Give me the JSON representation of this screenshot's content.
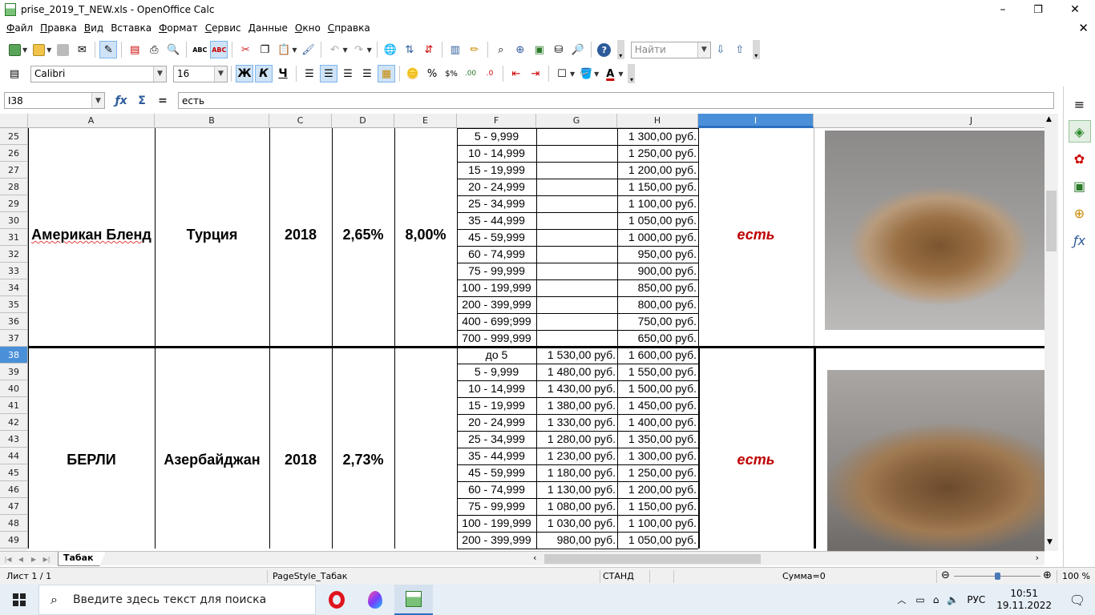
{
  "window": {
    "title": "prise_2019_T_NEW.xls - OpenOffice Calc",
    "min": "–",
    "max": "❐",
    "close": "✕",
    "doc_close": "✕"
  },
  "menu": [
    {
      "label": "Файл",
      "u": "Ф",
      "rest": "айл"
    },
    {
      "label": "Правка",
      "u": "П",
      "rest": "равка"
    },
    {
      "label": "Вид",
      "u": "В",
      "rest": "ид"
    },
    {
      "label": "Вставка",
      "u": "",
      "rest": "Вставка"
    },
    {
      "label": "Формат",
      "u": "Ф",
      "rest": "ормат"
    },
    {
      "label": "Сервис",
      "u": "С",
      "rest": "ервис"
    },
    {
      "label": "Данные",
      "u": "Д",
      "rest": "анные"
    },
    {
      "label": "Окно",
      "u": "О",
      "rest": "кно"
    },
    {
      "label": "Справка",
      "u": "С",
      "rest": "правка"
    }
  ],
  "toolbar1": {
    "find_placeholder": "Найти"
  },
  "toolbar2": {
    "font_name": "Calibri",
    "font_size": "16",
    "bold": "Ж",
    "italic": "К",
    "underline": "Ч",
    "percent": "%",
    "currency": "$%"
  },
  "formula_bar": {
    "name_box": "I38",
    "content": "есть",
    "equals": "="
  },
  "columns": [
    "A",
    "B",
    "C",
    "D",
    "E",
    "F",
    "G",
    "H",
    "I",
    "J"
  ],
  "selected_column": "I",
  "rows": [
    "25",
    "26",
    "27",
    "28",
    "29",
    "30",
    "31",
    "32",
    "33",
    "34",
    "35",
    "36",
    "37",
    "38",
    "39",
    "40",
    "41",
    "42",
    "43",
    "44",
    "45",
    "46",
    "47",
    "48",
    "49"
  ],
  "selected_row": "38",
  "products": [
    {
      "name": "Американ Бленд",
      "country": "Турция",
      "year": "2018",
      "d": "2,65%",
      "e": "8,00%",
      "availability": "есть"
    },
    {
      "name": "БЕРЛИ",
      "country": "Азербайджан",
      "year": "2018",
      "d": "2,73%",
      "e": "",
      "availability": "есть"
    }
  ],
  "price_rows_1": [
    {
      "range": "5 - 9,999",
      "g": "",
      "h": "1 300,00 руб."
    },
    {
      "range": "10 - 14,999",
      "g": "",
      "h": "1 250,00 руб."
    },
    {
      "range": "15 - 19,999",
      "g": "",
      "h": "1 200,00 руб."
    },
    {
      "range": "20 - 24,999",
      "g": "",
      "h": "1 150,00 руб."
    },
    {
      "range": "25 - 34,999",
      "g": "",
      "h": "1 100,00 руб."
    },
    {
      "range": "35 - 44,999",
      "g": "",
      "h": "1 050,00 руб."
    },
    {
      "range": "45 - 59,999",
      "g": "",
      "h": "1 000,00 руб."
    },
    {
      "range": "60 - 74,999",
      "g": "",
      "h": "950,00 руб."
    },
    {
      "range": "75 - 99,999",
      "g": "",
      "h": "900,00 руб."
    },
    {
      "range": "100 - 199,999",
      "g": "",
      "h": "850,00 руб."
    },
    {
      "range": "200 - 399,999",
      "g": "",
      "h": "800,00 руб."
    },
    {
      "range": "400 - 699;999",
      "g": "",
      "h": "750,00 руб."
    },
    {
      "range": "700 - 999,999",
      "g": "",
      "h": "650,00 руб."
    }
  ],
  "price_rows_2": [
    {
      "range": "до 5",
      "g": "1 530,00 руб.",
      "h": "1 600,00 руб."
    },
    {
      "range": "5 - 9,999",
      "g": "1 480,00 руб.",
      "h": "1 550,00 руб."
    },
    {
      "range": "10 - 14,999",
      "g": "1 430,00 руб.",
      "h": "1 500,00 руб."
    },
    {
      "range": "15 - 19,999",
      "g": "1 380,00 руб.",
      "h": "1 450,00 руб."
    },
    {
      "range": "20 - 24,999",
      "g": "1 330,00 руб.",
      "h": "1 400,00 руб."
    },
    {
      "range": "25 - 34,999",
      "g": "1 280,00 руб.",
      "h": "1 350,00 руб."
    },
    {
      "range": "35 - 44,999",
      "g": "1 230,00 руб.",
      "h": "1 300,00 руб."
    },
    {
      "range": "45 - 59,999",
      "g": "1 180,00 руб.",
      "h": "1 250,00 руб."
    },
    {
      "range": "60 - 74,999",
      "g": "1 130,00 руб.",
      "h": "1 200,00 руб."
    },
    {
      "range": "75 - 99,999",
      "g": "1 080,00 руб.",
      "h": "1 150,00 руб."
    },
    {
      "range": "100 - 199,999",
      "g": "1 030,00 руб.",
      "h": "1 100,00 руб."
    },
    {
      "range": "200 - 399,999",
      "g": "980,00 руб.",
      "h": "1 050,00 руб."
    }
  ],
  "sheet_tab": "Табак",
  "status": {
    "sheet": "Лист 1 / 1",
    "page_style": "PageStyle_Табак",
    "mode": "СТАНД",
    "sum": "Сумма=0",
    "zoom": "100 %",
    "zoom_level_percent": 100
  },
  "taskbar": {
    "search_placeholder": "Введите здесь текст для поиска",
    "lang": "РУС",
    "time": "10:51",
    "date": "19.11.2022"
  },
  "colors": {
    "selection": "#4a90d9",
    "availability_red": "#c00000"
  }
}
